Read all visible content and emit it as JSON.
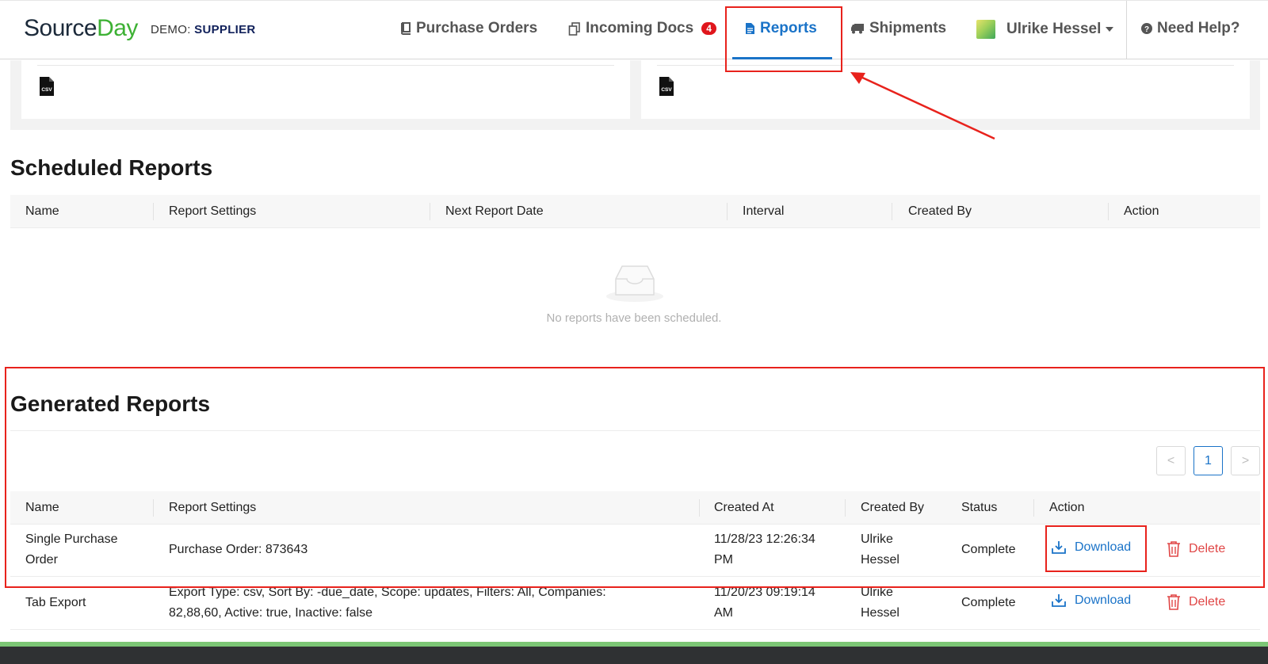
{
  "brand": {
    "name_part1": "Source",
    "name_part2": "Day",
    "demo_label": "DEMO:",
    "demo_value": "SUPPLIER"
  },
  "nav": {
    "purchase_orders": "Purchase Orders",
    "incoming_docs": "Incoming Docs",
    "incoming_docs_count": "4",
    "reports": "Reports",
    "shipments": "Shipments",
    "user": "Ulrike Hessel",
    "help": "Need Help?"
  },
  "top_cards": {
    "left_file": "csv-icon",
    "right_file": "csv-icon"
  },
  "scheduled": {
    "title": "Scheduled Reports",
    "columns": [
      "Name",
      "Report Settings",
      "Next Report Date",
      "Interval",
      "Created By",
      "Action"
    ],
    "empty_text": "No reports have been scheduled."
  },
  "generated": {
    "title": "Generated Reports",
    "pager": {
      "prev": "<",
      "current": "1",
      "next": ">"
    },
    "columns": [
      "Name",
      "Report Settings",
      "Created At",
      "Created By",
      "Status",
      "Action"
    ],
    "rows": [
      {
        "name": "Single Purchase Order",
        "settings": "Purchase Order: 873643",
        "created_at": "11/28/23 12:26:34 PM",
        "created_by": "Ulrike Hessel",
        "status": "Complete",
        "download": "Download",
        "delete": "Delete"
      },
      {
        "name": "Tab Export",
        "settings": "Export Type: csv, Sort By: -due_date, Scope: updates, Filters: All, Companies: 82,88,60, Active: true, Inactive: false",
        "created_at": "11/20/23 09:19:14 AM",
        "created_by": "Ulrike Hessel",
        "status": "Complete",
        "download": "Download",
        "delete": "Delete"
      }
    ]
  },
  "colors": {
    "accent": "#1a73c8",
    "brand_green": "#3db134",
    "danger": "#e04646",
    "annotation": "#e8221c"
  }
}
